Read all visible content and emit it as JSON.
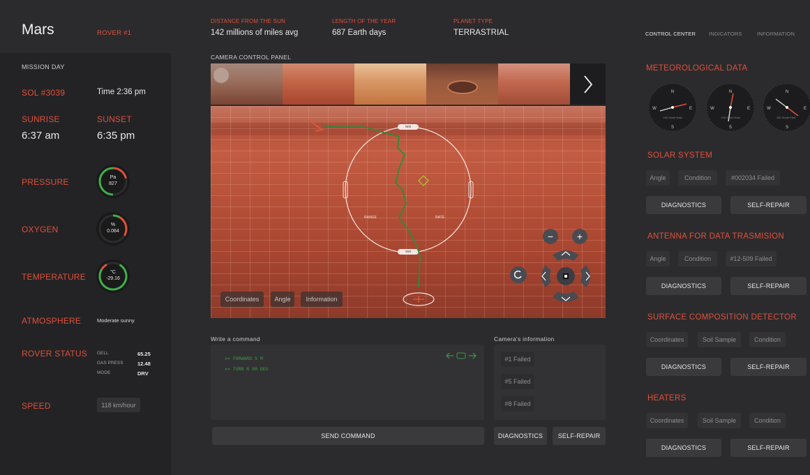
{
  "header": {
    "planet": "Mars",
    "rover": "ROVER #1",
    "facts": [
      {
        "label": "DISTANCE FROM THE SUN",
        "value": "142 millions of miles avg"
      },
      {
        "label": "LENGTH OF THE YEAR",
        "value": "687 Earth days"
      },
      {
        "label": "PLANET TYPE",
        "value": "TERRASTRIAL"
      }
    ],
    "nav": [
      "CONTROL CENTER",
      "INDICATORS",
      "INFORMATION"
    ]
  },
  "sidebar": {
    "mission_day_label": "MISSION DAY",
    "sol": "SOL #3039",
    "time": "Time 2:36 pm",
    "sunrise_label": "SUNRISE",
    "sunrise": "6:37 am",
    "sunset_label": "SUNSET",
    "sunset": "6:35 pm",
    "pressure": {
      "label": "PRESSURE",
      "unit": "Pa",
      "value": "827",
      "level": 0.7
    },
    "oxygen": {
      "label": "OXYGEN",
      "unit": "%",
      "value": "0.064",
      "level": 0.3
    },
    "temperature": {
      "label": "TEMPERATURE",
      "unit": "°C",
      "value": "-29.16",
      "level": 0.85
    },
    "atmosphere": {
      "label": "ATMOSPHERE",
      "value": "Moderate sunny"
    },
    "rover_status": {
      "label": "ROVER STATUS",
      "rows": [
        {
          "key": "GELL",
          "value": "65.25"
        },
        {
          "key": "GAS PRESS",
          "value": "12.48"
        },
        {
          "key": "MODE",
          "value": "DRV"
        }
      ]
    },
    "speed": {
      "label": "SPEED",
      "value": "118 km/hour"
    }
  },
  "camera": {
    "panel_label": "CAMERA CONTROL PANEL",
    "buttons": [
      "Coordinates",
      "Angle",
      "Information"
    ],
    "hud": {
      "top": "N00",
      "bottom": "S00",
      "range": "RANGE",
      "rate": "RATE"
    }
  },
  "command": {
    "label": "Write a command",
    "lines": [
      ">> FORWARD 5 M",
      ">> TURN R 90 DEG"
    ],
    "send": "SEND COMMAND"
  },
  "camera_info": {
    "label": "Camera's information",
    "items": [
      "#1 Failed",
      "#5 Failed",
      "#8 Failed"
    ],
    "diagnostics": "DIAGNOSTICS",
    "self_repair": "SELF-REPAIR"
  },
  "right": {
    "meteo_title": "METEOROLOGICAL DATA",
    "compass_caption": "150 South East",
    "sections": [
      {
        "title": "SOLAR SYSTEM",
        "chips": [
          "Angle",
          "Condition",
          "#002034 Failed"
        ]
      },
      {
        "title": "ANTENNA FOR DATA TRASMISION",
        "chips": [
          "Angle",
          "Condition",
          "#12-509 Failed"
        ]
      },
      {
        "title": "SURFACE COMPOSITION DETECTOR",
        "chips": [
          "Coordinates",
          "Soil Sample",
          "Condition"
        ]
      },
      {
        "title": "HEATERS",
        "chips": [
          "Coordinates",
          "Soil Sample",
          "Condition"
        ]
      }
    ],
    "diagnostics": "DIAGNOSTICS",
    "self_repair": "SELF-REPAIR"
  },
  "colors": {
    "accent": "#e0503a",
    "gauge_green": "#3fae4a",
    "terminal_green": "#3c9a46"
  }
}
